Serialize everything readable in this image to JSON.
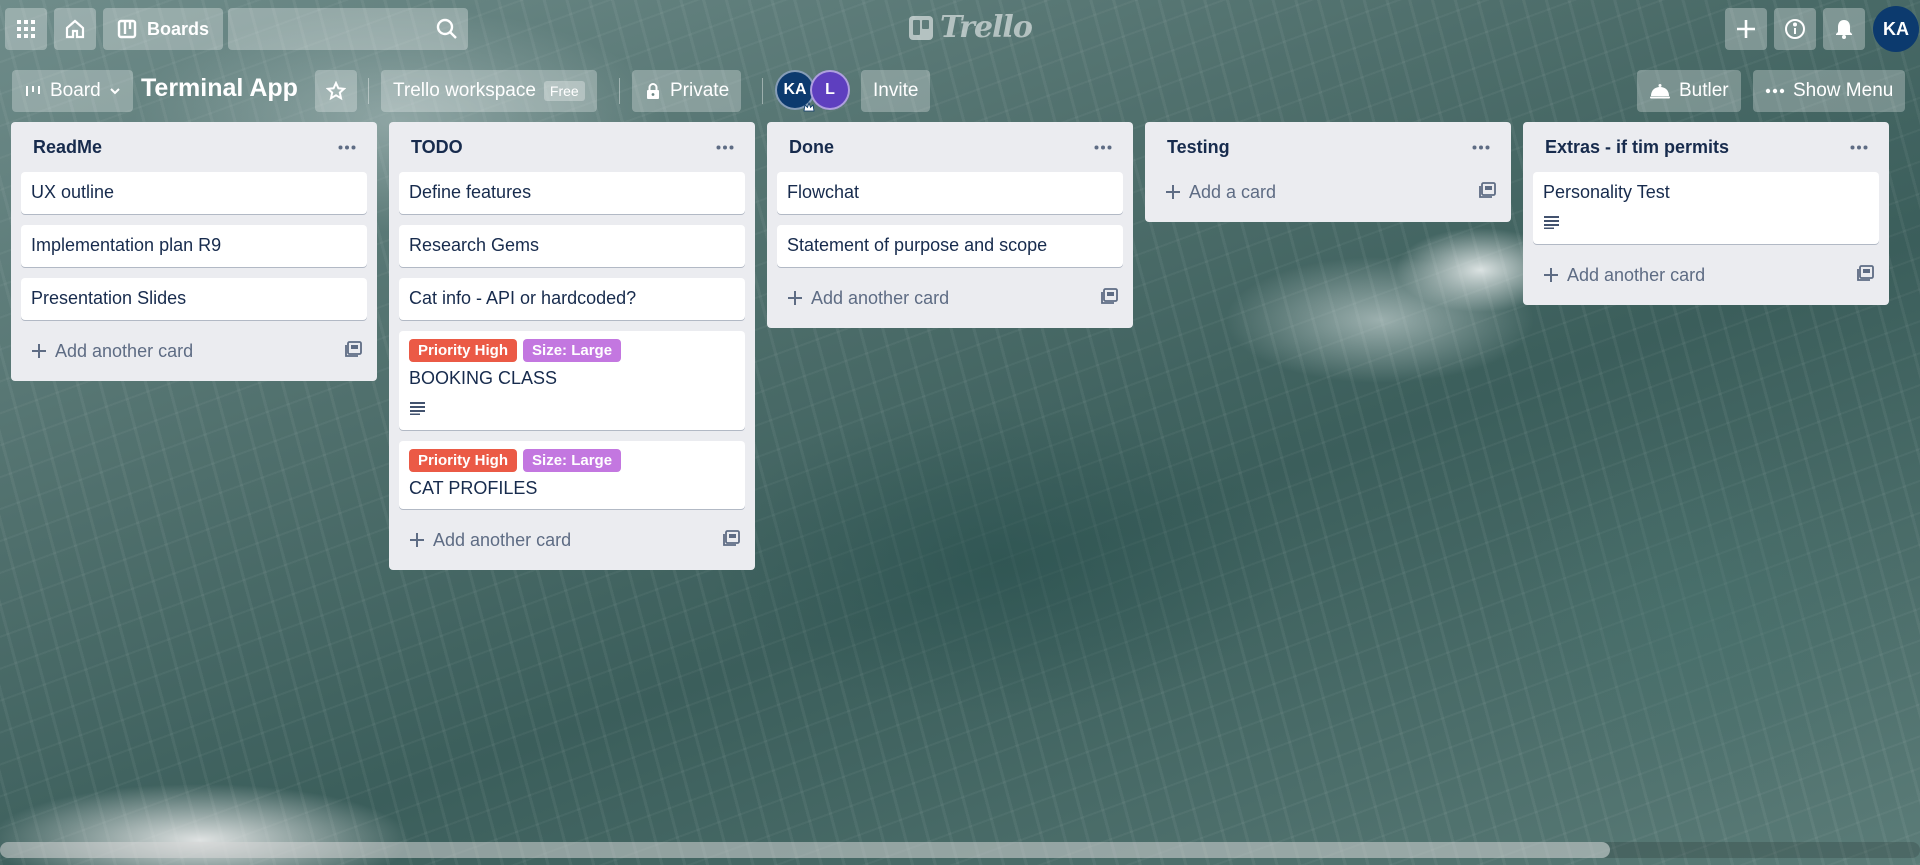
{
  "header": {
    "boards_label": "Boards",
    "search_placeholder": "",
    "logo_text": "Trello",
    "user_initials": "KA"
  },
  "board": {
    "view_label": "Board",
    "title": "Terminal App",
    "workspace_label": "Trello workspace",
    "workspace_badge": "Free",
    "visibility_label": "Private",
    "members": [
      {
        "initials": "KA",
        "color": "#0c3a6e"
      },
      {
        "initials": "L",
        "color": "#5e3fbf"
      }
    ],
    "invite_label": "Invite",
    "butler_label": "Butler",
    "show_menu_label": "Show Menu"
  },
  "labels": {
    "priority_high": {
      "text": "Priority High",
      "color": "#eb5a46"
    },
    "size_large": {
      "text": "Size: Large",
      "color": "#c377e0"
    }
  },
  "lists": [
    {
      "title": "ReadMe",
      "cards": [
        "UX outline",
        "Implementation plan R9",
        "Presentation Slides"
      ],
      "add_label": "Add another card"
    },
    {
      "title": "TODO",
      "cards": [
        "Define features",
        "Research Gems",
        "Cat info - API or hardcoded?",
        "BOOKING CLASS",
        "CAT PROFILES"
      ],
      "add_label": "Add another card"
    },
    {
      "title": "Done",
      "cards": [
        "Flowchat",
        "Statement of purpose and scope"
      ],
      "add_label": "Add another card"
    },
    {
      "title": "Testing",
      "cards": [],
      "add_label": "Add a card"
    },
    {
      "title": "Extras - if tim permits",
      "cards": [
        "Personality Test"
      ],
      "add_label": "Add another card"
    }
  ]
}
